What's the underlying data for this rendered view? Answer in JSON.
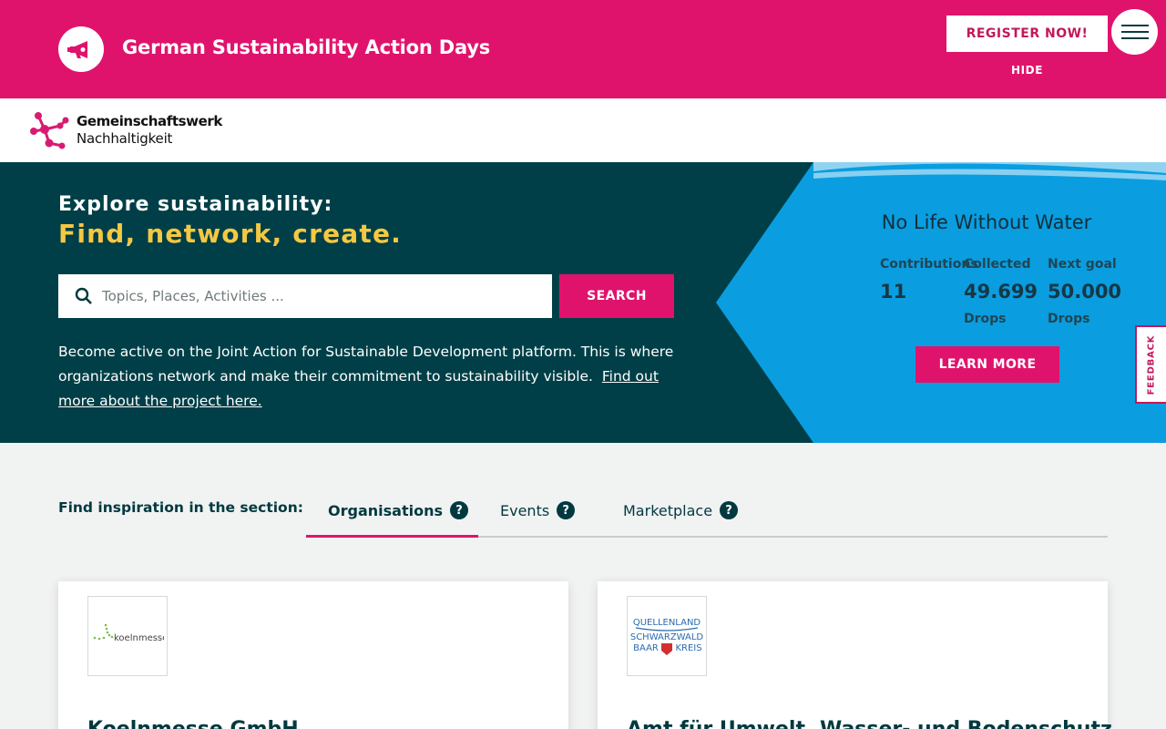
{
  "banner": {
    "title": "German Sustainability Action Days",
    "register_label": "REGISTER NOW!",
    "hide_label": "HIDE"
  },
  "logo": {
    "line1": "Gemeinschaftswerk",
    "line2": "Nachhaltigkeit"
  },
  "hero": {
    "heading": "Explore sustainability:",
    "subheading": "Find, network, create.",
    "search_placeholder": "Topics, Places, Activities ...",
    "search_button": "SEARCH",
    "description": "Become active on the Joint Action for Sustainable Development platform. This is where organizations network and make their commitment to sustainability visible.",
    "link_text": "Find out more about the project here."
  },
  "campaign": {
    "title": "No Life Without Water",
    "stats": [
      {
        "label": "Contributions",
        "value": "11",
        "unit": ""
      },
      {
        "label": "Collected",
        "value": "49.699",
        "unit": "Drops"
      },
      {
        "label": "Next goal",
        "value": "50.000",
        "unit": "Drops"
      }
    ],
    "learn_more": "LEARN MORE"
  },
  "feedback_label": "FEEDBACK",
  "sections": {
    "label": "Find inspiration in the section:",
    "tabs": [
      {
        "label": "Organisations",
        "active": true
      },
      {
        "label": "Events",
        "active": false
      },
      {
        "label": "Marketplace",
        "active": false
      }
    ],
    "help_glyph": "?"
  },
  "cards": [
    {
      "title": "Koelnmesse GmbH",
      "logo_text": "koelnmesse"
    },
    {
      "title": "Amt für Umwelt, Wasser- und Bodenschutz",
      "logo_text": [
        "QUELLENLAND",
        "SCHWARZWALD",
        "BAAR",
        "KREIS"
      ]
    }
  ],
  "colors": {
    "brand_pink": "#e0136c",
    "hero_dark": "#003f47",
    "water_blue": "#0a9de0",
    "accent_yellow": "#f5c842"
  }
}
